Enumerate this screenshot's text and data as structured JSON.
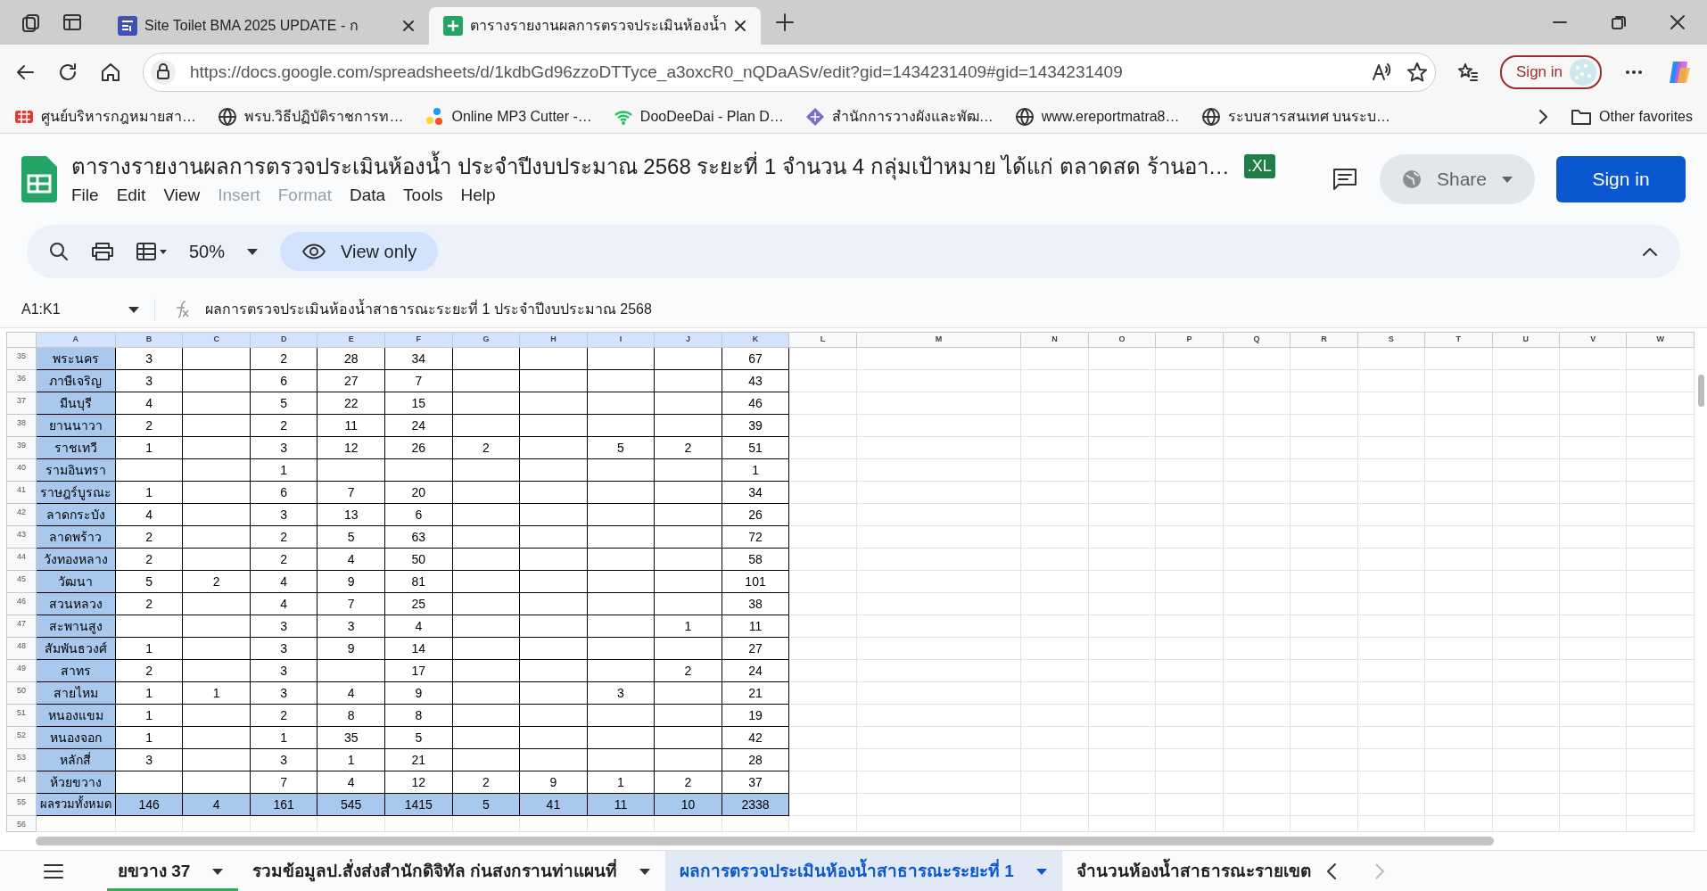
{
  "browser": {
    "tabs": [
      {
        "title": "Site Toilet BMA 2025 UPDATE - ก",
        "kind": "forms",
        "selected": false
      },
      {
        "title": "ตารางรายงานผลการตรวจประเมินห้องน้ำ",
        "kind": "sheets",
        "selected": true
      }
    ],
    "url": "https://docs.google.com/spreadsheets/d/1kdbGd96zzoDTTyce_a3oxcR0_nQDaASv/edit?gid=1434231409#gid=1434231409",
    "sign_in": "Sign in",
    "bookmarks": [
      {
        "label": "ศูนย์บริหารกฎหมายสา…",
        "kind": "grid"
      },
      {
        "label": "พรบ.วิธีปฏิบัติราชการท…",
        "kind": "globe"
      },
      {
        "label": "Online MP3 Cutter -…",
        "kind": "dots"
      },
      {
        "label": "DooDeeDai - Plan D…",
        "kind": "wifi"
      },
      {
        "label": "สำนักการวางผังและพัฒ…",
        "kind": "diamond"
      },
      {
        "label": "www.ereportmatra8…",
        "kind": "globe"
      },
      {
        "label": "ระบบสารสนเทศ บนระบ…",
        "kind": "globe"
      }
    ],
    "other_favorites": "Other favorites"
  },
  "sheets": {
    "title": "ตารางรายงานผลการตรวจประเมินห้องน้ำ ประจำปีงบประมาณ 2568 ระยะที่ 1 จำนวน 4 กลุ่มเป้าหมาย ได้แก่ ตลาดสด ร้านอา…",
    "file_badge": ".XL",
    "menus": [
      {
        "label": "File",
        "disabled": false
      },
      {
        "label": "Edit",
        "disabled": false
      },
      {
        "label": "View",
        "disabled": false
      },
      {
        "label": "Insert",
        "disabled": true
      },
      {
        "label": "Format",
        "disabled": true
      },
      {
        "label": "Data",
        "disabled": false
      },
      {
        "label": "Tools",
        "disabled": false
      },
      {
        "label": "Help",
        "disabled": false
      }
    ],
    "share": "Share",
    "sign_in": "Sign in",
    "zoom": "50%",
    "view_only": "View only",
    "name_box": "A1:K1",
    "formula": "ผลการตรวจประเมินห้องน้ำสาธารณะระยะที่ 1 ประจำปีงบประมาณ 2568"
  },
  "columns": [
    {
      "label": "A",
      "selected": true
    },
    {
      "label": "B",
      "selected": true
    },
    {
      "label": "C",
      "selected": true
    },
    {
      "label": "D",
      "selected": true
    },
    {
      "label": "E",
      "selected": true
    },
    {
      "label": "F",
      "selected": true
    },
    {
      "label": "G",
      "selected": true
    },
    {
      "label": "H",
      "selected": true
    },
    {
      "label": "I",
      "selected": true
    },
    {
      "label": "J",
      "selected": true
    },
    {
      "label": "K",
      "selected": true
    },
    {
      "label": "L",
      "selected": false
    },
    {
      "label": "M",
      "selected": false
    },
    {
      "label": "N",
      "selected": false
    },
    {
      "label": "O",
      "selected": false
    },
    {
      "label": "P",
      "selected": false
    },
    {
      "label": "Q",
      "selected": false
    },
    {
      "label": "R",
      "selected": false
    },
    {
      "label": "S",
      "selected": false
    },
    {
      "label": "T",
      "selected": false
    },
    {
      "label": "U",
      "selected": false
    },
    {
      "label": "V",
      "selected": false
    },
    {
      "label": "W",
      "selected": false
    }
  ],
  "rows": [
    {
      "number": "35",
      "kind": "data",
      "cells": [
        "พระนคร",
        "3",
        null,
        "2",
        "28",
        "34",
        null,
        null,
        null,
        null,
        "67"
      ]
    },
    {
      "number": "36",
      "kind": "data",
      "cells": [
        "ภาษีเจริญ",
        "3",
        null,
        "6",
        "27",
        "7",
        null,
        null,
        null,
        null,
        "43"
      ]
    },
    {
      "number": "37",
      "kind": "data",
      "cells": [
        "มีนบุรี",
        "4",
        null,
        "5",
        "22",
        "15",
        null,
        null,
        null,
        null,
        "46"
      ]
    },
    {
      "number": "38",
      "kind": "data",
      "cells": [
        "ยานนาวา",
        "2",
        null,
        "2",
        "11",
        "24",
        null,
        null,
        null,
        null,
        "39"
      ]
    },
    {
      "number": "39",
      "kind": "data",
      "cells": [
        "ราชเทวี",
        "1",
        null,
        "3",
        "12",
        "26",
        "2",
        null,
        "5",
        "2",
        "51"
      ]
    },
    {
      "number": "40",
      "kind": "data",
      "cells": [
        "รามอินทรา",
        null,
        null,
        "1",
        null,
        null,
        null,
        null,
        null,
        null,
        "1"
      ]
    },
    {
      "number": "41",
      "kind": "data",
      "cells": [
        "ราษฎร์บูรณะ",
        "1",
        null,
        "6",
        "7",
        "20",
        null,
        null,
        null,
        null,
        "34"
      ]
    },
    {
      "number": "42",
      "kind": "data",
      "cells": [
        "ลาดกระบัง",
        "4",
        null,
        "3",
        "13",
        "6",
        null,
        null,
        null,
        null,
        "26"
      ]
    },
    {
      "number": "43",
      "kind": "data",
      "cells": [
        "ลาดพร้าว",
        "2",
        null,
        "2",
        "5",
        "63",
        null,
        null,
        null,
        null,
        "72"
      ]
    },
    {
      "number": "44",
      "kind": "data",
      "cells": [
        "วังทองหลาง",
        "2",
        null,
        "2",
        "4",
        "50",
        null,
        null,
        null,
        null,
        "58"
      ]
    },
    {
      "number": "45",
      "kind": "data",
      "cells": [
        "วัฒนา",
        "5",
        "2",
        "4",
        "9",
        "81",
        null,
        null,
        null,
        null,
        "101"
      ]
    },
    {
      "number": "46",
      "kind": "data",
      "cells": [
        "สวนหลวง",
        "2",
        null,
        "4",
        "7",
        "25",
        null,
        null,
        null,
        null,
        "38"
      ]
    },
    {
      "number": "47",
      "kind": "data",
      "cells": [
        "สะพานสูง",
        null,
        null,
        "3",
        "3",
        "4",
        null,
        null,
        null,
        "1",
        "11"
      ]
    },
    {
      "number": "48",
      "kind": "data",
      "cells": [
        "สัมพันธวงศ์",
        "1",
        null,
        "3",
        "9",
        "14",
        null,
        null,
        null,
        null,
        "27"
      ]
    },
    {
      "number": "49",
      "kind": "data",
      "cells": [
        "สาทร",
        "2",
        null,
        "3",
        null,
        "17",
        null,
        null,
        null,
        "2",
        "24"
      ]
    },
    {
      "number": "50",
      "kind": "data",
      "cells": [
        "สายไหม",
        "1",
        "1",
        "3",
        "4",
        "9",
        null,
        null,
        "3",
        null,
        "21"
      ]
    },
    {
      "number": "51",
      "kind": "data",
      "cells": [
        "หนองแขม",
        "1",
        null,
        "2",
        "8",
        "8",
        null,
        null,
        null,
        null,
        "19"
      ]
    },
    {
      "number": "52",
      "kind": "data",
      "cells": [
        "หนองจอก",
        "1",
        null,
        "1",
        "35",
        "5",
        null,
        null,
        null,
        null,
        "42"
      ]
    },
    {
      "number": "53",
      "kind": "data",
      "cells": [
        "หลักสี่",
        "3",
        null,
        "3",
        "1",
        "21",
        null,
        null,
        null,
        null,
        "28"
      ]
    },
    {
      "number": "54",
      "kind": "data",
      "cells": [
        "ห้วยขวาง",
        null,
        null,
        "7",
        "4",
        "12",
        "2",
        "9",
        "1",
        "2",
        "37"
      ]
    },
    {
      "number": "55",
      "kind": "total",
      "cells": [
        "ผลรวมทั้งหมด",
        "146",
        "4",
        "161",
        "545",
        "1415",
        "5",
        "41",
        "11",
        "10",
        "2338"
      ]
    },
    {
      "number": "56",
      "kind": "empty"
    }
  ],
  "sheet_tabs": [
    {
      "label": "ยขวาง 37",
      "selected": false,
      "color": "#34a853"
    },
    {
      "label": "รวมข้อมูลป.สั่งส่งสำนักดิจิทัล ก่นสงกรานท่าแผนที่",
      "selected": false
    },
    {
      "label": "ผลการตรวจประเมินห้องน้ำสาธารณะระยะที่ 1",
      "selected": true
    },
    {
      "label": "จำนวนห้องน้ำสาธารณะรายเขต",
      "selected": false
    }
  ]
}
